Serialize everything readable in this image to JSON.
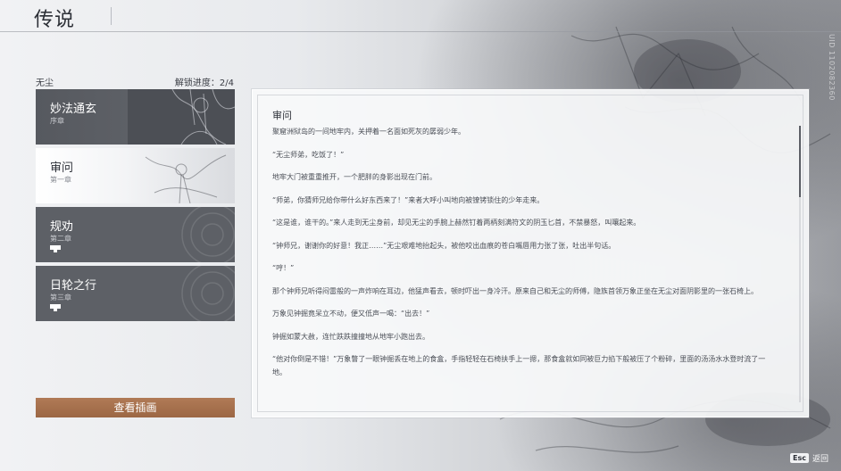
{
  "header": {
    "title": "传说"
  },
  "side_id": "UID 1102082360",
  "sidebar": {
    "character_name": "无尘",
    "progress": "解锁进度：2/4",
    "chapters": [
      {
        "name": "妙法通玄",
        "sub": "序章",
        "state": "unlocked"
      },
      {
        "name": "审问",
        "sub": "第一章",
        "state": "selected"
      },
      {
        "name": "规劝",
        "sub": "第二章",
        "state": "locked"
      },
      {
        "name": "日轮之行",
        "sub": "第三章",
        "state": "locked"
      }
    ],
    "view_button": "查看插画"
  },
  "story": {
    "title": "审问",
    "paragraphs": [
      "聚窟洲狱岛的一间地牢内，关押着一名面如死灰的孱弱少年。",
      "“无尘师弟，吃饭了！”",
      "地牢大门被重重推开，一个肥胖的身影出现在门前。",
      "“师弟，你猜师兄给你带什么好东西来了！”来者大呼小叫地向被镣铐锁住的少年走来。",
      "“这是谁，谁干的。”来人走到无尘身前，却见无尘的手腕上赫然钉着两柄刻满符文的阴玉匕首，不禁暴怒，叫嚷起来。",
      "“钟师兄，谢谢你的好意！我正……”无尘艰难地抬起头，被他咬出血痕的苍白嘴唇用力张了张，吐出半句话。",
      "“哼！”",
      "那个钟师兄听得闷雷般的一声炸响在耳边，他猛声看去，顿时吓出一身冷汗。原来自己和无尘的师傅，隐族首领万象正坐在无尘对面阴影里的一张石椅上。",
      "万象见钟掘竟呆立不动，便又低声一喝：“出去！”",
      "钟掘如蒙大赦，连忙跌跌撞撞地从地牢小跑出去。",
      "“他对你倒是不错！”万象瞥了一眼钟掘丢在地上的食盒，手指轻轻在石椅扶手上一摁，那食盒就如同被巨力掐下般被压了个粉碎，里面的汤汤水水登时流了一地。"
    ]
  },
  "footer": {
    "esc_key": "Esc",
    "esc_label": "返回"
  },
  "colors": {
    "accent_button": "#a56f4b",
    "selected_card": "#f3f4f6",
    "card_dark": "#5d6066",
    "text_dark": "#2d3038"
  }
}
